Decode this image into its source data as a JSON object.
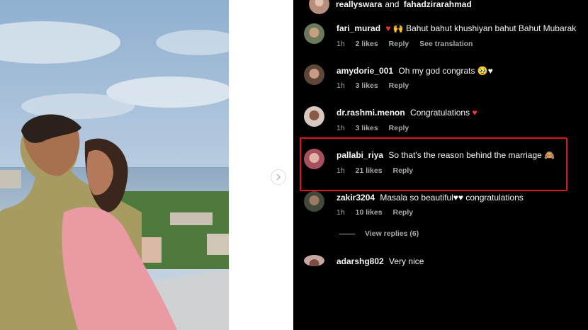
{
  "header": {
    "user_a": "reallyswara",
    "joiner": "and",
    "user_b": "fahadzirarahmad"
  },
  "comments": [
    {
      "username": "fari_murad",
      "text": "Bahut bahut khushiyan bahut Bahut Mubarak",
      "emoji_prefix": "♥ 🙌",
      "emoji_suffix": "",
      "time": "1h",
      "likes": "2 likes",
      "reply": "Reply",
      "extra": "See translation"
    },
    {
      "username": "amydorie_001",
      "text": "Oh my god congrats",
      "emoji_prefix": "",
      "emoji_suffix": "🥹♥",
      "time": "1h",
      "likes": "3 likes",
      "reply": "Reply",
      "extra": ""
    },
    {
      "username": "dr.rashmi.menon",
      "text": "Congratulations",
      "emoji_prefix": "",
      "emoji_suffix": "♥",
      "time": "1h",
      "likes": "3 likes",
      "reply": "Reply",
      "extra": ""
    },
    {
      "username": "pallabi_riya",
      "text": "So that's the reason behind the marriage",
      "emoji_prefix": "",
      "emoji_suffix": "🙈",
      "time": "1h",
      "likes": "21 likes",
      "reply": "Reply",
      "extra": ""
    },
    {
      "username": "zakir3204",
      "text": "Masala so beautiful♥♥ congratulations",
      "emoji_prefix": "",
      "emoji_suffix": "",
      "time": "1h",
      "likes": "10 likes",
      "reply": "Reply",
      "extra": ""
    },
    {
      "username": "adarshg802",
      "text": "Very nice",
      "emoji_prefix": "",
      "emoji_suffix": "",
      "time": "",
      "likes": "",
      "reply": "",
      "extra": ""
    }
  ],
  "view_replies": "View replies (6)",
  "colors": {
    "panel_bg": "#000000",
    "highlight": "#e0141e",
    "heart": "#ff3040",
    "meta": "#a8a8a8"
  },
  "icons": {
    "next": "chevron-right-icon"
  }
}
